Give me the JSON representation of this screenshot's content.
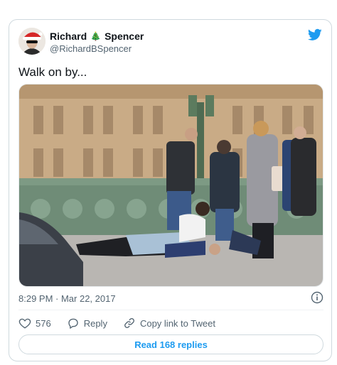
{
  "tweet": {
    "author": {
      "name_first": "Richard",
      "name_emoji": "🎄",
      "name_last": "Spencer",
      "handle": "@RichardBSpencer"
    },
    "text": "Walk on by...",
    "timestamp": "8:29 PM · Mar 22, 2017",
    "likes": "576",
    "reply_label": "Reply",
    "copy_link_label": "Copy link to Tweet",
    "read_replies_label": "Read 168 replies"
  },
  "colors": {
    "brand": "#1d9bf0",
    "secondary_text": "#536471",
    "border": "#cfd9de"
  },
  "icons": {
    "brand": "twitter-bird-icon",
    "info": "info-icon",
    "like": "heart-icon",
    "reply": "reply-bubble-icon",
    "copy_link": "link-icon"
  }
}
